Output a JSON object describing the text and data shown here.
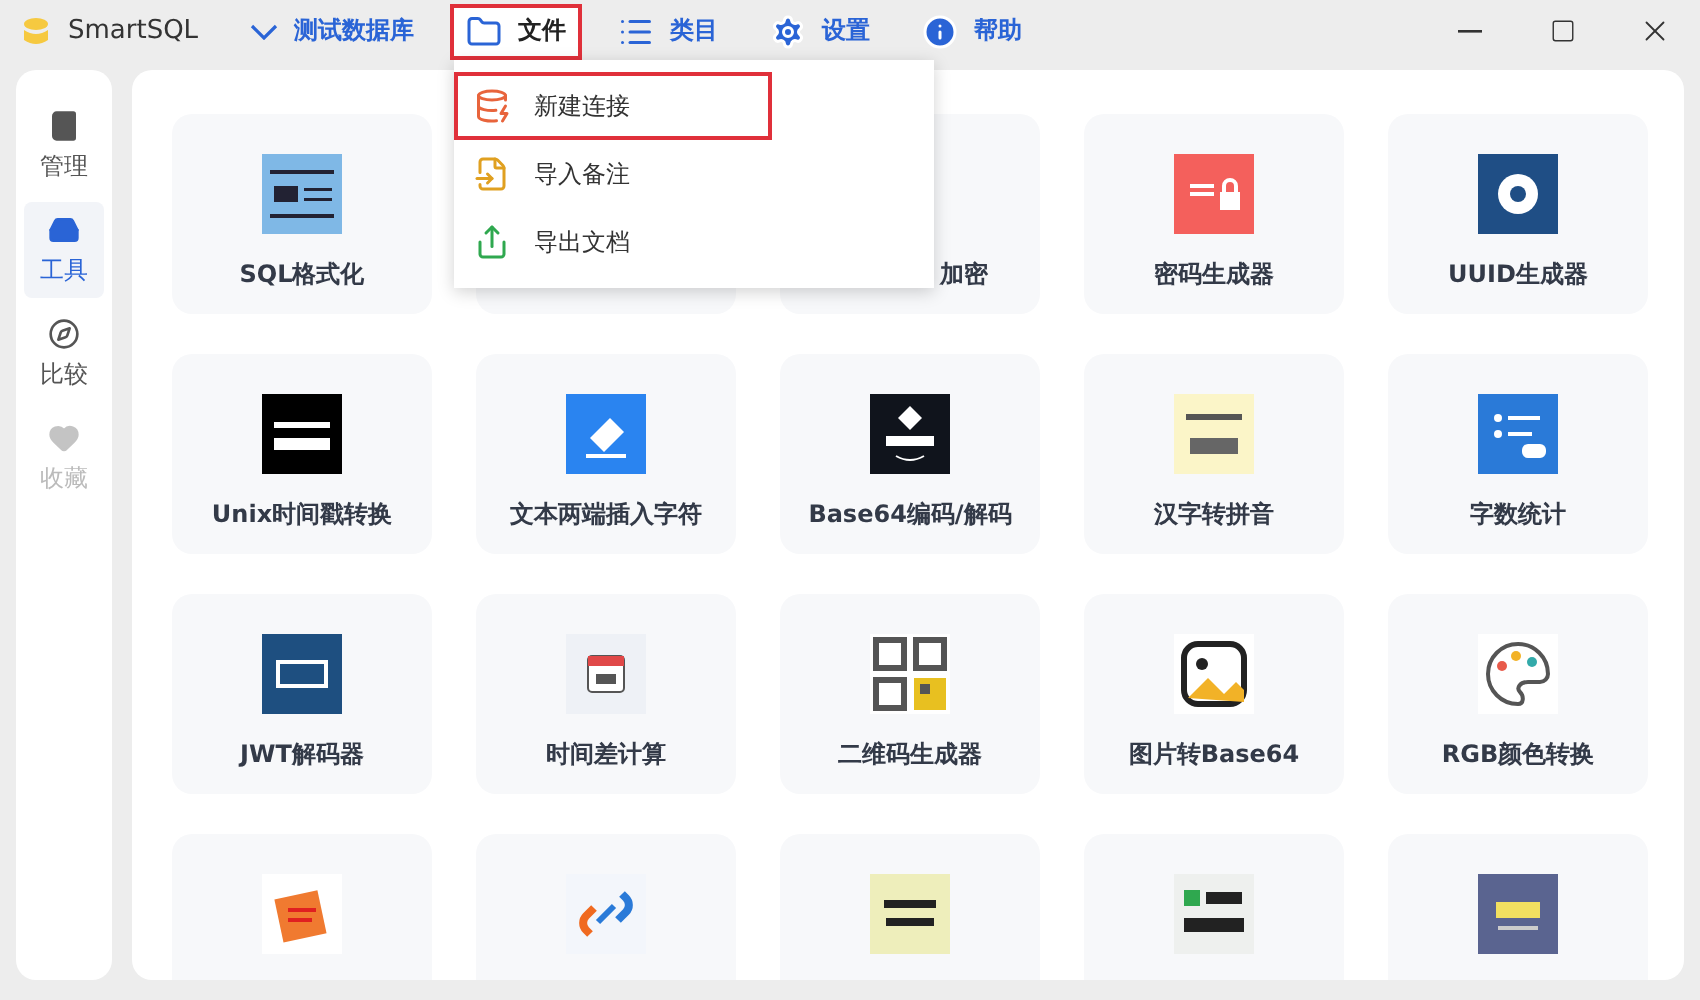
{
  "app": {
    "title": "SmartSQL"
  },
  "menu_bar": [
    {
      "label": "测试数据库",
      "kind": "database",
      "highlighted": false,
      "open": false
    },
    {
      "label": "文件",
      "kind": "file",
      "highlighted": true,
      "open": true
    },
    {
      "label": "类目",
      "kind": "category",
      "highlighted": false,
      "open": false
    },
    {
      "label": "设置",
      "kind": "settings",
      "highlighted": false,
      "open": false
    },
    {
      "label": "帮助",
      "kind": "help",
      "highlighted": false,
      "open": false
    }
  ],
  "file_menu": [
    {
      "label": "新建连接",
      "highlighted": true
    },
    {
      "label": "导入备注",
      "highlighted": false
    },
    {
      "label": "导出文档",
      "highlighted": false
    }
  ],
  "sidebar": [
    {
      "label": "管理",
      "selected": false,
      "disabled": false
    },
    {
      "label": "工具",
      "selected": true,
      "disabled": false
    },
    {
      "label": "比较",
      "selected": false,
      "disabled": false
    },
    {
      "label": "收藏",
      "selected": false,
      "disabled": true
    }
  ],
  "tools": [
    {
      "kind": "card",
      "label": "SQL格式化"
    },
    {
      "kind": "covered"
    },
    {
      "kind": "covered",
      "label": "加密"
    },
    {
      "kind": "card",
      "label": "密码生成器"
    },
    {
      "kind": "card",
      "label": "UUID生成器"
    },
    {
      "kind": "card",
      "label": "Unix时间戳转换"
    },
    {
      "kind": "card",
      "label": "文本两端插入字符"
    },
    {
      "kind": "card",
      "label": "Base64编码/解码"
    },
    {
      "kind": "card",
      "label": "汉字转拼音"
    },
    {
      "kind": "card",
      "label": "字数统计"
    },
    {
      "kind": "card",
      "label": "JWT解码器"
    },
    {
      "kind": "card",
      "label": "时间差计算"
    },
    {
      "kind": "card",
      "label": "二维码生成器"
    },
    {
      "kind": "card",
      "label": "图片转Base64"
    },
    {
      "kind": "card",
      "label": "RGB颜色转换"
    },
    {
      "kind": "card"
    },
    {
      "kind": "card"
    },
    {
      "kind": "card"
    },
    {
      "kind": "card"
    },
    {
      "kind": "card"
    }
  ]
}
